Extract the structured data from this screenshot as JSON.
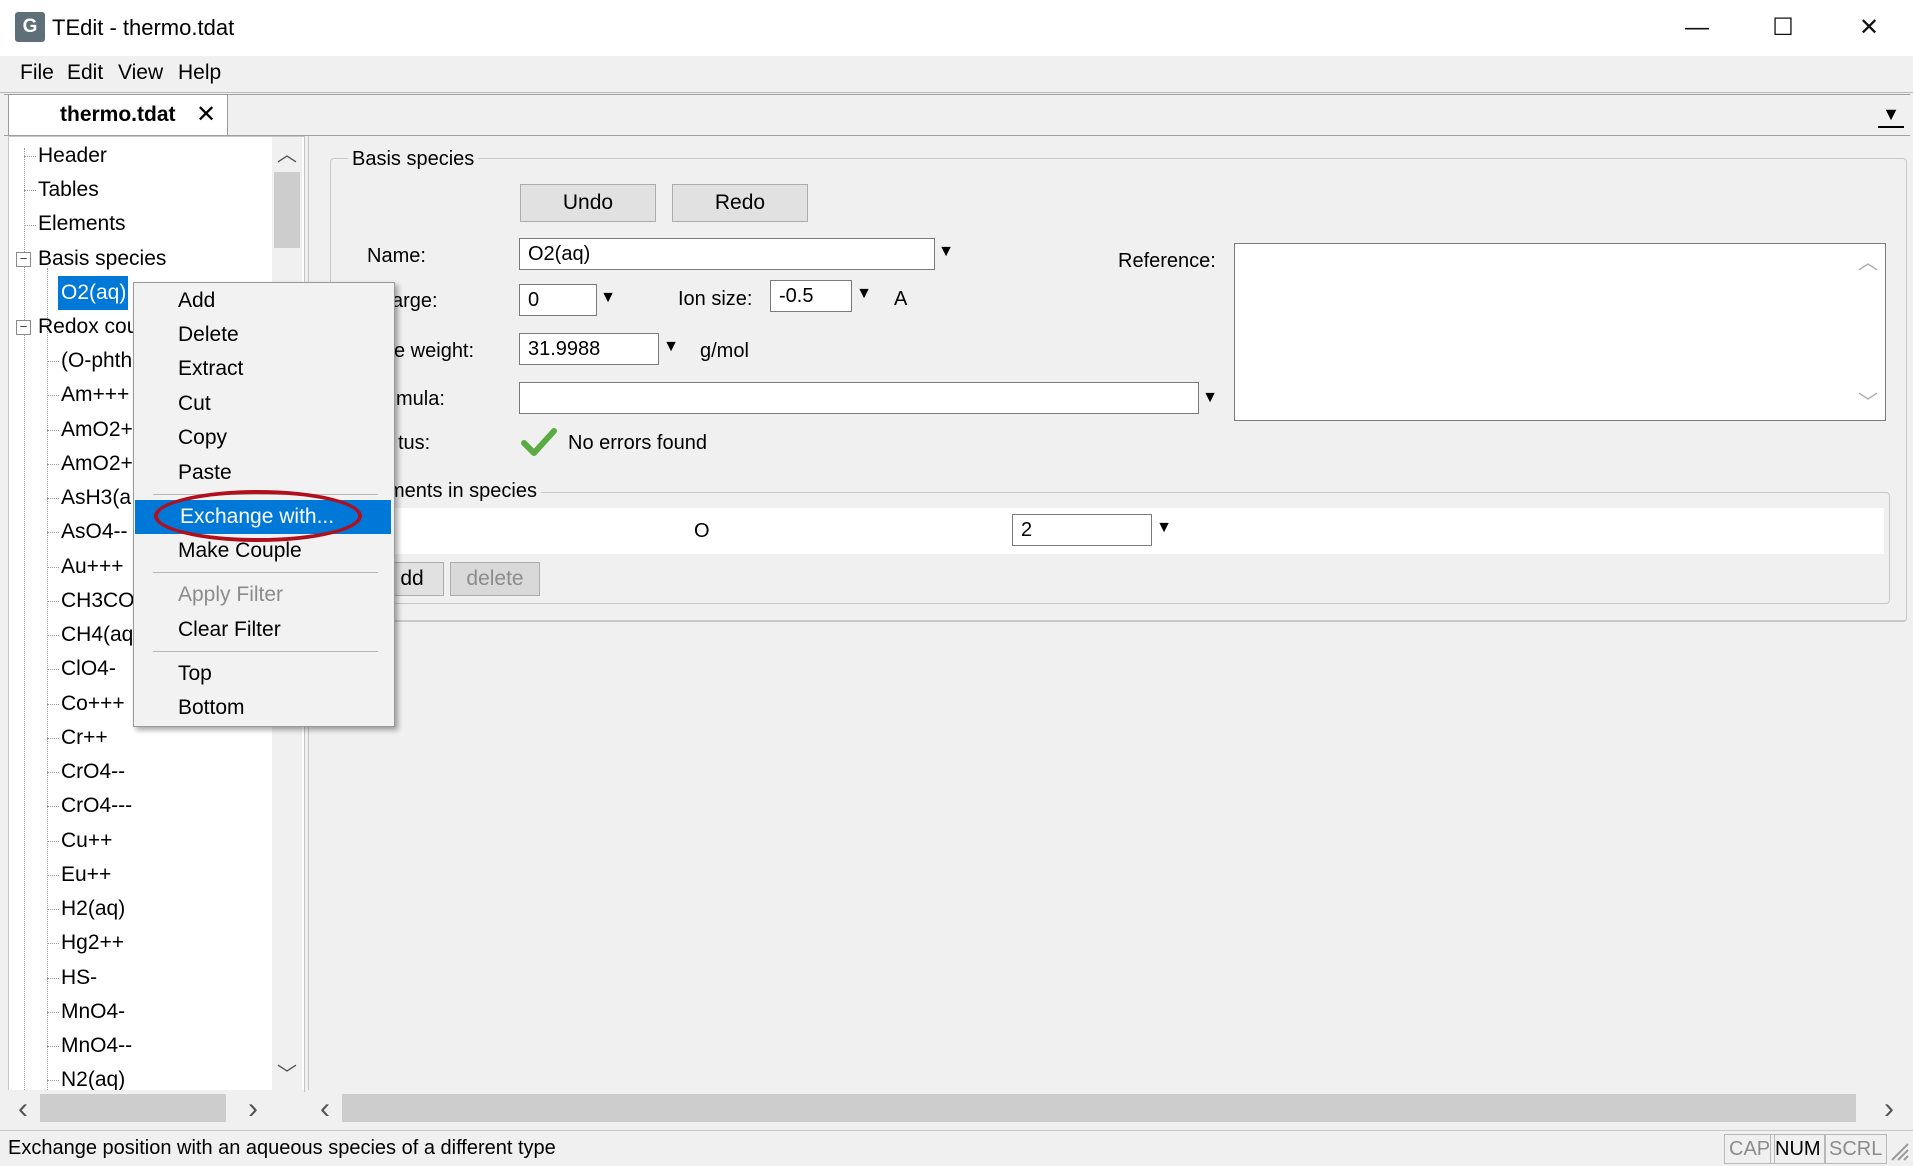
{
  "window": {
    "title": "TEdit - thermo.tdat",
    "app_icon_glyph": "G",
    "minimize_glyph": "—",
    "maximize_glyph": "☐",
    "close_glyph": "✕"
  },
  "menu": [
    "File",
    "Edit",
    "View",
    "Help"
  ],
  "tab": {
    "label": "thermo.tdat",
    "close_glyph": "✕",
    "dropdown_glyph": "▼"
  },
  "tree": {
    "top_items": [
      "Header",
      "Tables",
      "Elements"
    ],
    "basis_label": "Basis species",
    "selected_item": "O2(aq)",
    "redox_label": "Redox cou",
    "redox_items": [
      "(O-phth",
      "Am+++",
      "AmO2+",
      "AmO2+",
      "AsH3(a",
      "AsO4--",
      "Au+++",
      "CH3CO",
      "CH4(aq",
      "ClO4-",
      "Co+++",
      "Cr++",
      "CrO4--",
      "CrO4---",
      "Cu++",
      "Eu++",
      "H2(aq)",
      "Hg2++",
      "HS-",
      "MnO4-",
      "MnO4--",
      "N2(aq)"
    ],
    "expander_minus": "−",
    "scroll_up": "︿",
    "scroll_down": "﹀",
    "scroll_left": "‹",
    "scroll_right": "›"
  },
  "form": {
    "group_title": "Basis species",
    "undo_label": "Undo",
    "redo_label": "Redo",
    "name_label": "Name:",
    "name_value": "O2(aq)",
    "charge_label": "arge:",
    "charge_value": "0",
    "ion_size_label": "Ion size:",
    "ion_size_value": "-0.5",
    "ion_size_unit": "A",
    "mole_weight_label": "e weight:",
    "mole_weight_value": "31.9988",
    "mole_weight_unit": "g/mol",
    "formula_label": "mula:",
    "formula_value": "",
    "status_label": "tus:",
    "status_text": "No errors found",
    "reference_label": "Reference:",
    "reference_value": "",
    "elements_title": "ments in species",
    "element_symbol": "O",
    "element_count": "2",
    "add_label": "dd",
    "delete_label": "delete",
    "dropdown_glyph": "▼",
    "check_color": "#4caf50"
  },
  "context_menu": {
    "items_group1": [
      "Add",
      "Delete",
      "Extract",
      "Cut",
      "Copy",
      "Paste"
    ],
    "highlighted": "Exchange with...",
    "make_couple": "Make Couple",
    "apply_filter": "Apply Filter",
    "clear_filter": "Clear Filter",
    "top": "Top",
    "bottom": "Bottom"
  },
  "statusbar": {
    "text": "Exchange position with an aqueous species of a different type",
    "cap": "CAP",
    "num": "NUM",
    "scrl": "SCRL"
  },
  "colors": {
    "selection": "#0078d7",
    "annotation_circle": "#b0101e"
  }
}
